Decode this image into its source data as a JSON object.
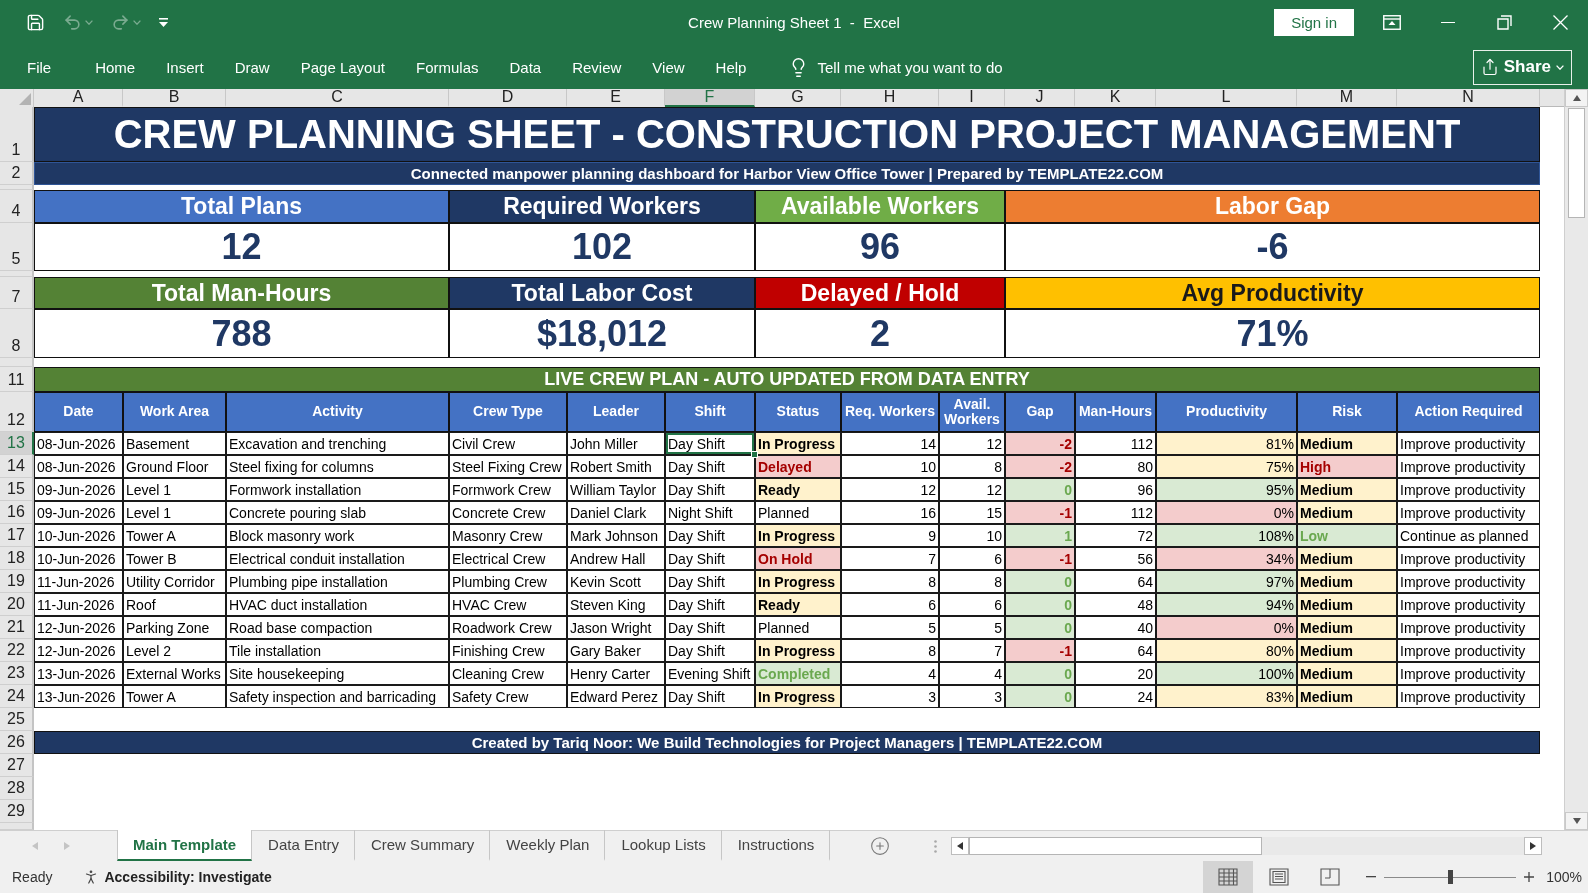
{
  "window": {
    "title": "Crew Planning Sheet 1  -  Excel",
    "sign_in": "Sign in"
  },
  "quick_access": [
    {
      "kind": "save",
      "disabled": false
    },
    {
      "kind": "undo",
      "disabled": true
    },
    {
      "kind": "redo",
      "disabled": true
    },
    {
      "kind": "customize",
      "disabled": false
    }
  ],
  "ribbon": {
    "tabs": [
      {
        "label": "File",
        "selected": false
      },
      {
        "label": "Home",
        "selected": false
      },
      {
        "label": "Insert",
        "selected": false
      },
      {
        "label": "Draw",
        "selected": false
      },
      {
        "label": "Page Layout",
        "selected": false
      },
      {
        "label": "Formulas",
        "selected": false
      },
      {
        "label": "Data",
        "selected": false
      },
      {
        "label": "Review",
        "selected": false
      },
      {
        "label": "View",
        "selected": false
      },
      {
        "label": "Help",
        "selected": false
      }
    ],
    "tell_me": {
      "placeholder": "Tell me what you want to do"
    },
    "share": "Share"
  },
  "sheet": {
    "column_headers": [
      {
        "label": "A",
        "selected": false
      },
      {
        "label": "B",
        "selected": false
      },
      {
        "label": "C",
        "selected": false
      },
      {
        "label": "D",
        "selected": false
      },
      {
        "label": "E",
        "selected": false
      },
      {
        "label": "F",
        "selected": true
      },
      {
        "label": "G",
        "selected": false
      },
      {
        "label": "H",
        "selected": false
      },
      {
        "label": "I",
        "selected": false
      },
      {
        "label": "J",
        "selected": false
      },
      {
        "label": "K",
        "selected": false
      },
      {
        "label": "L",
        "selected": false
      },
      {
        "label": "M",
        "selected": false
      },
      {
        "label": "N",
        "selected": false
      }
    ],
    "row_headers": [
      {
        "label": "1",
        "selected": false
      },
      {
        "label": "2",
        "selected": false
      },
      {
        "label": "4",
        "selected": false
      },
      {
        "label": "5",
        "selected": false
      },
      {
        "label": "7",
        "selected": false
      },
      {
        "label": "8",
        "selected": false
      },
      {
        "label": "11",
        "selected": false
      },
      {
        "label": "12",
        "selected": false
      },
      {
        "label": "13",
        "selected": true
      },
      {
        "label": "14",
        "selected": false
      },
      {
        "label": "15",
        "selected": false
      },
      {
        "label": "16",
        "selected": false
      },
      {
        "label": "17",
        "selected": false
      },
      {
        "label": "18",
        "selected": false
      },
      {
        "label": "19",
        "selected": false
      },
      {
        "label": "20",
        "selected": false
      },
      {
        "label": "21",
        "selected": false
      },
      {
        "label": "22",
        "selected": false
      },
      {
        "label": "23",
        "selected": false
      },
      {
        "label": "24",
        "selected": false
      },
      {
        "label": "25",
        "selected": false
      },
      {
        "label": "26",
        "selected": false
      },
      {
        "label": "27",
        "selected": false
      },
      {
        "label": "28",
        "selected": false
      },
      {
        "label": "29",
        "selected": false
      }
    ],
    "title": "CREW PLANNING SHEET - CONSTRUCTION PROJECT MANAGEMENT",
    "subtitle": "Connected manpower planning dashboard for Harbor View Office Tower | Prepared by TEMPLATE22.COM",
    "kpis": [
      [
        {
          "label": "Total Plans",
          "value": "12",
          "color": "#4472c4"
        },
        {
          "label": "Required Workers",
          "value": "102",
          "color": "#1f3864"
        },
        {
          "label": "Available Workers",
          "value": "96",
          "color": "#70ad47"
        },
        {
          "label": "Labor Gap",
          "value": "-6",
          "color": "#ed7d31"
        }
      ],
      [
        {
          "label": "Total Man-Hours",
          "value": "788",
          "color": "#548235"
        },
        {
          "label": "Total Labor Cost",
          "value": "$18,012",
          "color": "#1f3864"
        },
        {
          "label": "Delayed / Hold",
          "value": "2",
          "color": "#c00000"
        },
        {
          "label": "Avg Productivity",
          "value": "71%",
          "color": "#ffc000"
        }
      ]
    ],
    "plan_title": "LIVE CREW PLAN - AUTO UPDATED FROM DATA ENTRY",
    "table": {
      "columns": [
        "Date",
        "Work Area",
        "Activity",
        "Crew Type",
        "Leader",
        "Shift",
        "Status",
        "Req. Workers",
        "Avail. Workers",
        "Gap",
        "Man-Hours",
        "Productivity",
        "Risk",
        "Action Required"
      ],
      "rows": [
        [
          "08-Jun-2026",
          "Basement",
          "Excavation and trenching",
          "Civil Crew",
          "John Miller",
          "Day Shift",
          {
            "text": "In Progress",
            "color": "#fff2cc"
          },
          "14",
          "12",
          {
            "text": "-2",
            "color": "#f4cccc"
          },
          "112",
          {
            "text": "81%",
            "color": "#fff2cc"
          },
          {
            "text": "Medium",
            "color": "#fff2cc"
          },
          "Improve productivity"
        ],
        [
          "08-Jun-2026",
          "Ground Floor",
          "Steel fixing for columns",
          "Steel Fixing Crew",
          "Robert Smith",
          "Day Shift",
          {
            "text": "Delayed",
            "color": "#f4cccc"
          },
          "10",
          "8",
          {
            "text": "-2",
            "color": "#f4cccc"
          },
          "80",
          {
            "text": "75%",
            "color": "#fff2cc"
          },
          {
            "text": "High",
            "color": "#f4cccc"
          },
          "Improve productivity"
        ],
        [
          "09-Jun-2026",
          "Level 1",
          "Formwork installation",
          "Formwork Crew",
          "William Taylor",
          "Day Shift",
          {
            "text": "Ready",
            "color": "#fff2cc"
          },
          "12",
          "12",
          {
            "text": "0",
            "color": "#d9ead3"
          },
          "96",
          {
            "text": "95%",
            "color": "#d9ead3"
          },
          {
            "text": "Medium",
            "color": "#fff2cc"
          },
          "Improve productivity"
        ],
        [
          "09-Jun-2026",
          "Level 1",
          "Concrete pouring slab",
          "Concrete Crew",
          "Daniel Clark",
          "Night Shift",
          "Planned",
          "16",
          "15",
          {
            "text": "-1",
            "color": "#f4cccc"
          },
          "112",
          {
            "text": "0%",
            "color": "#f4cccc"
          },
          {
            "text": "Medium",
            "color": "#fff2cc"
          },
          "Improve productivity"
        ],
        [
          "10-Jun-2026",
          "Tower A",
          "Block masonry work",
          "Masonry Crew",
          "Mark Johnson",
          "Day Shift",
          {
            "text": "In Progress",
            "color": "#fff2cc"
          },
          "9",
          "10",
          {
            "text": "1",
            "color": "#d9ead3"
          },
          "72",
          {
            "text": "108%",
            "color": "#d9ead3"
          },
          {
            "text": "Low",
            "color": "#d9ead3"
          },
          "Continue as planned"
        ],
        [
          "10-Jun-2026",
          "Tower B",
          "Electrical conduit installation",
          "Electrical Crew",
          "Andrew Hall",
          "Day Shift",
          {
            "text": "On Hold",
            "color": "#f4cccc"
          },
          "7",
          "6",
          {
            "text": "-1",
            "color": "#f4cccc"
          },
          "56",
          {
            "text": "34%",
            "color": "#f4cccc"
          },
          {
            "text": "Medium",
            "color": "#fff2cc"
          },
          "Improve productivity"
        ],
        [
          "11-Jun-2026",
          "Utility Corridor",
          "Plumbing pipe installation",
          "Plumbing Crew",
          "Kevin Scott",
          "Day Shift",
          {
            "text": "In Progress",
            "color": "#fff2cc"
          },
          "8",
          "8",
          {
            "text": "0",
            "color": "#d9ead3"
          },
          "64",
          {
            "text": "97%",
            "color": "#d9ead3"
          },
          {
            "text": "Medium",
            "color": "#fff2cc"
          },
          "Improve productivity"
        ],
        [
          "11-Jun-2026",
          "Roof",
          "HVAC duct installation",
          "HVAC Crew",
          "Steven King",
          "Day Shift",
          {
            "text": "Ready",
            "color": "#fff2cc"
          },
          "6",
          "6",
          {
            "text": "0",
            "color": "#d9ead3"
          },
          "48",
          {
            "text": "94%",
            "color": "#d9ead3"
          },
          {
            "text": "Medium",
            "color": "#fff2cc"
          },
          "Improve productivity"
        ],
        [
          "12-Jun-2026",
          "Parking Zone",
          "Road base compaction",
          "Roadwork Crew",
          "Jason Wright",
          "Day Shift",
          "Planned",
          "5",
          "5",
          {
            "text": "0",
            "color": "#d9ead3"
          },
          "40",
          {
            "text": "0%",
            "color": "#f4cccc"
          },
          {
            "text": "Medium",
            "color": "#fff2cc"
          },
          "Improve productivity"
        ],
        [
          "12-Jun-2026",
          "Level 2",
          "Tile installation",
          "Finishing Crew",
          "Gary Baker",
          "Day Shift",
          {
            "text": "In Progress",
            "color": "#fff2cc"
          },
          "8",
          "7",
          {
            "text": "-1",
            "color": "#f4cccc"
          },
          "64",
          {
            "text": "80%",
            "color": "#fff2cc"
          },
          {
            "text": "Medium",
            "color": "#fff2cc"
          },
          "Improve productivity"
        ],
        [
          "13-Jun-2026",
          "External Works",
          "Site housekeeping",
          "Cleaning Crew",
          "Henry Carter",
          "Evening Shift",
          {
            "text": "Completed",
            "color": "#d9ead3"
          },
          "4",
          "4",
          {
            "text": "0",
            "color": "#d9ead3"
          },
          "20",
          {
            "text": "100%",
            "color": "#d9ead3"
          },
          {
            "text": "Medium",
            "color": "#fff2cc"
          },
          "Improve productivity"
        ],
        [
          "13-Jun-2026",
          "Tower A",
          "Safety inspection and barricading",
          "Safety Crew",
          "Edward Perez",
          "Day Shift",
          {
            "text": "In Progress",
            "color": "#fff2cc"
          },
          "3",
          "3",
          {
            "text": "0",
            "color": "#d9ead3"
          },
          "24",
          {
            "text": "83%",
            "color": "#fff2cc"
          },
          {
            "text": "Medium",
            "color": "#fff2cc"
          },
          "Improve productivity"
        ]
      ]
    },
    "footer": "Created by Tariq Noor: We Build Technologies for Project Managers | TEMPLATE22.COM"
  },
  "sheet_tabs": [
    {
      "label": "Main Template",
      "selected": true
    },
    {
      "label": "Data Entry",
      "selected": false
    },
    {
      "label": "Crew Summary",
      "selected": false
    },
    {
      "label": "Weekly Plan",
      "selected": false
    },
    {
      "label": "Lookup Lists",
      "selected": false
    },
    {
      "label": "Instructions",
      "selected": false
    }
  ],
  "status_bar": {
    "status": "Ready",
    "accessibility": "Accessibility: Investigate",
    "views": [
      {
        "kind": "normal",
        "selected": true
      },
      {
        "kind": "page_layout",
        "selected": false
      },
      {
        "kind": "page_break",
        "selected": false
      }
    ],
    "zoom": {
      "level": 0.5,
      "reading": "100%"
    }
  }
}
